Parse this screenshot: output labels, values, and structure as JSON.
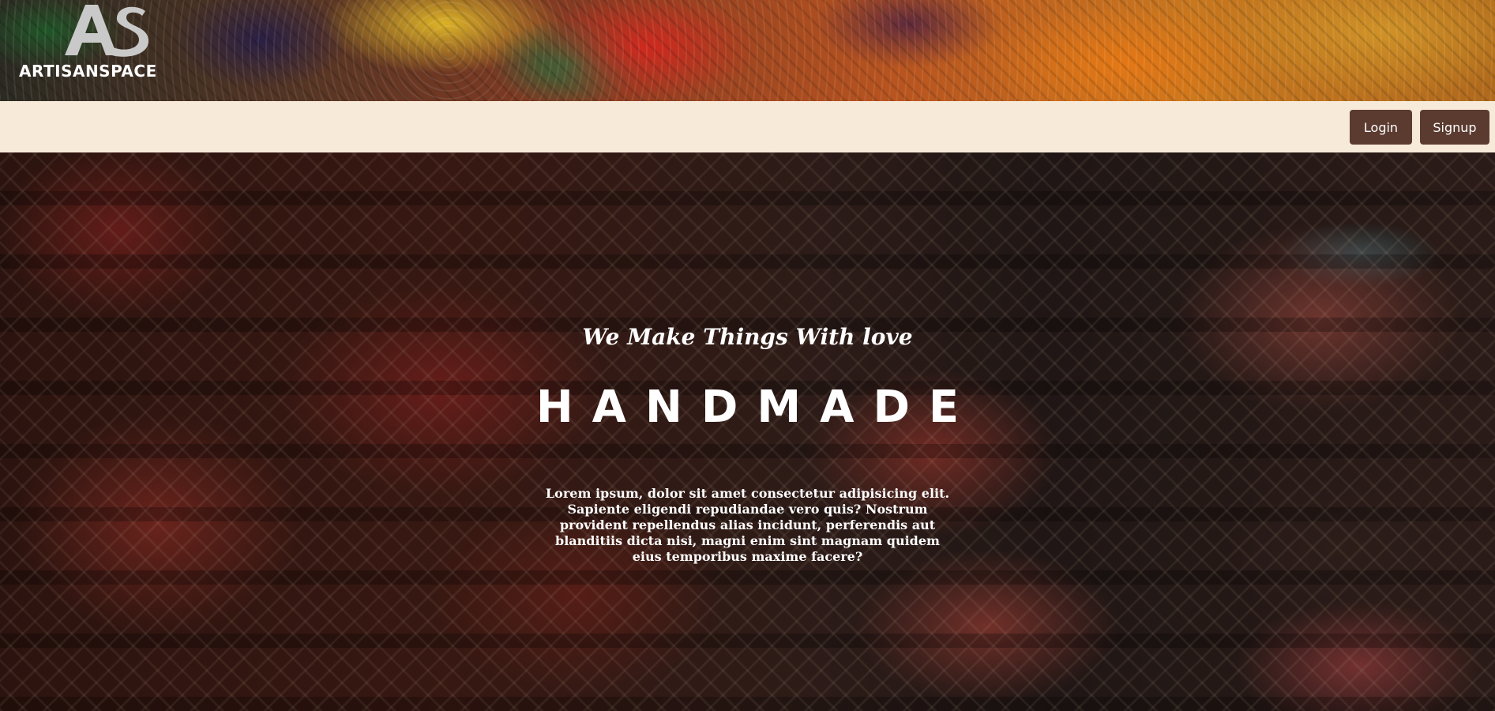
{
  "brand": {
    "logo_mark_text": "AS",
    "name": "ARTISANSPACE"
  },
  "nav": {
    "login_label": "Login",
    "signup_label": "Signup"
  },
  "hero": {
    "tagline": "We Make Things With love",
    "headline": "HANDMADE",
    "description": "Lorem ipsum, dolor sit amet consectetur adipisicing elit. Sapiente eligendi repudiandae vero quis? Nostrum provident repellendus alias incidunt, perferendis aut blanditiis dicta nisi, magni enim sint magnam quidem eius temporibus maxime facere?"
  },
  "colors": {
    "nav_background": "#f8ead9",
    "button_background": "#5b3b30",
    "text_light": "#ffffff"
  },
  "icons": {
    "logo": "as-monogram-logo"
  }
}
